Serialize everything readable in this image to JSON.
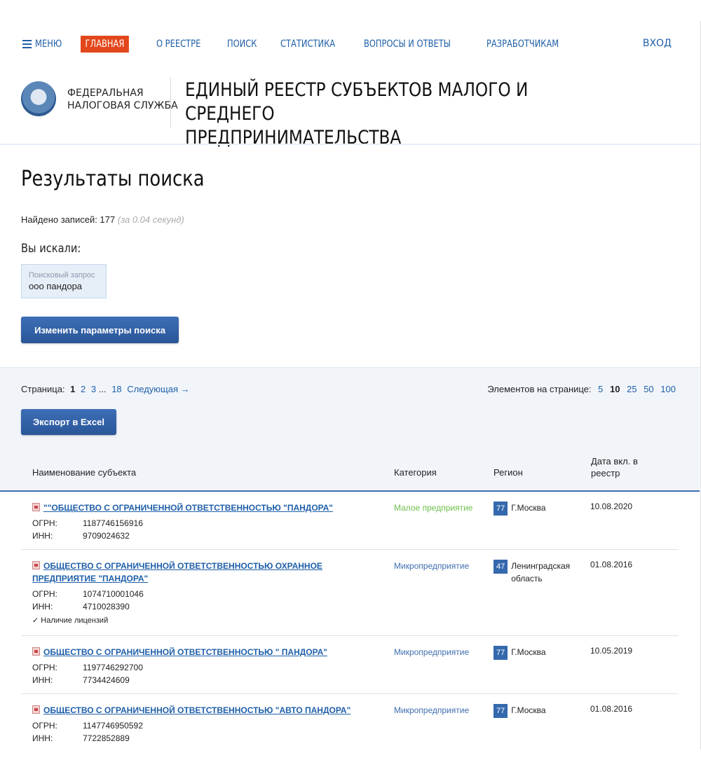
{
  "nav": {
    "menu": "МЕНЮ",
    "items": [
      "ГЛАВНАЯ",
      "О РЕЕСТРЕ",
      "ПОИСК",
      "СТАТИСТИКА",
      "ВОПРОСЫ И ОТВЕТЫ",
      "РАЗРАБОТЧИКАМ"
    ],
    "active_index": 0,
    "login": "ВХОД"
  },
  "header": {
    "logo_line1": "ФЕДЕРАЛЬНАЯ",
    "logo_line2": "НАЛОГОВАЯ СЛУЖБА",
    "title_line1": "ЕДИНЫЙ РЕЕСТР СУБЪЕКТОВ МАЛОГО И СРЕДНЕГО",
    "title_line2": "ПРЕДПРИНИМАТЕЛЬСТВА"
  },
  "search": {
    "page_title": "Результаты поиска",
    "found_label": "Найдено записей: 177",
    "found_time": "(за 0.04 секунд)",
    "sought_label": "Вы искали:",
    "query_label": "Поисковый запрос",
    "query_value": "ооо пандора",
    "change_button": "Изменить параметры поиска"
  },
  "pagination": {
    "label": "Страница:",
    "current": "1",
    "pages": [
      "2",
      "3"
    ],
    "ellipsis": "...",
    "last": "18",
    "next": "Следующая →",
    "per_page_label": "Элементов на странице:",
    "per_page_options": [
      "5",
      "10",
      "25",
      "50",
      "100"
    ],
    "per_page_selected": "10"
  },
  "export_button": "Экспорт в Excel",
  "table": {
    "headers": {
      "name": "Наименование субъекта",
      "category": "Категория",
      "region": "Регион",
      "date_line1": "Дата вкл. в",
      "date_line2": "реестр"
    },
    "ogrn_label": "ОГРН:",
    "inn_label": "ИНН:",
    "rows": [
      {
        "name": "\"\"ОБЩЕСТВО С ОГРАНИЧЕННОЙ ОТВЕТСТВЕННОСТЬЮ \"ПАНДОРА\"",
        "ogrn": "1187746156916",
        "inn": "9709024632",
        "license": "",
        "category": "Малое предприятие",
        "category_color": "#6cc04a",
        "region_code": "77",
        "region_name": "Г.Москва",
        "date": "10.08.2020"
      },
      {
        "name": "ОБЩЕСТВО С ОГРАНИЧЕННОЙ ОТВЕТСТВЕННОСТЬЮ ОХРАННОЕ ПРЕДПРИЯТИЕ \"ПАНДОРА\"",
        "ogrn": "1074710001046",
        "inn": "4710028390",
        "license": "✓ Наличие лицензий",
        "category": "Микропредприятие",
        "category_color": "#3f6eb0",
        "region_code": "47",
        "region_name": "Ленинградская область",
        "date": "01.08.2016"
      },
      {
        "name": "ОБЩЕСТВО С ОГРАНИЧЕННОЙ ОТВЕТСТВЕННОСТЬЮ \" ПАНДОРА\"",
        "ogrn": "1197746292700",
        "inn": "7734424609",
        "license": "",
        "category": "Микропредприятие",
        "category_color": "#3f6eb0",
        "region_code": "77",
        "region_name": "Г.Москва",
        "date": "10.05.2019"
      },
      {
        "name": "ОБЩЕСТВО С ОГРАНИЧЕННОЙ ОТВЕТСТВЕННОСТЬЮ \"АВТО ПАНДОРА\"",
        "ogrn": "1147746950592",
        "inn": "7722852889",
        "license": "",
        "category": "Микропредприятие",
        "category_color": "#3f6eb0",
        "region_code": "77",
        "region_name": "Г.Москва",
        "date": "01.08.2016"
      }
    ]
  }
}
